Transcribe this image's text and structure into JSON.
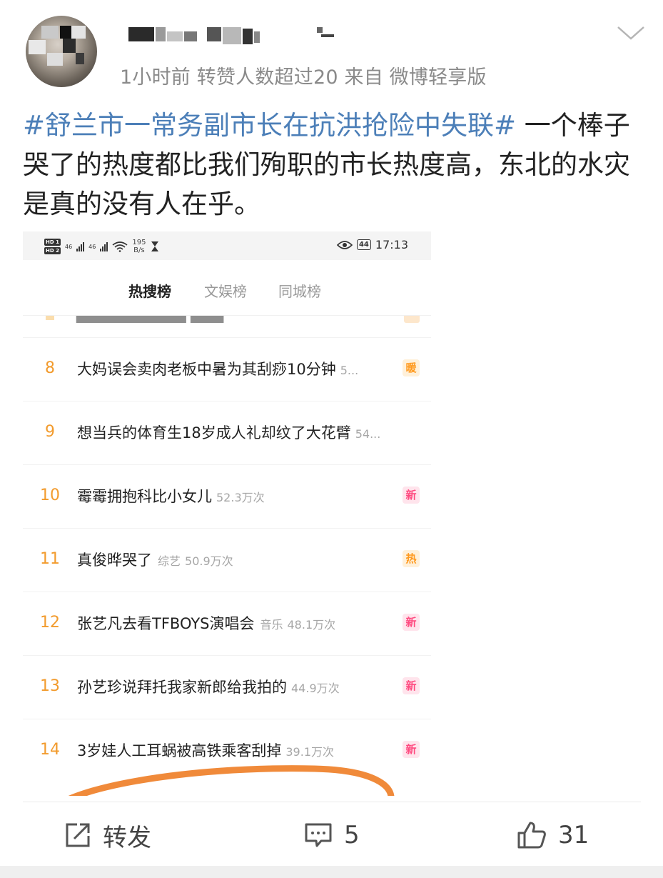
{
  "post": {
    "meta": "1小时前  转赞人数超过20   来自  微博轻享版",
    "hashtag": "#舒兰市一常务副市长在抗洪抢险中失联#",
    "body": " 一个棒子哭了的热度都比我们殉职的市长热度高，东北的水灾是真的没有人在乎。"
  },
  "screenshot": {
    "status_bar": {
      "hd1": "HD 1",
      "hd2": "HD 2",
      "net1": "46",
      "net2": "46",
      "speed_value": "195",
      "speed_unit": "B/s",
      "battery": "44",
      "time": "17:13"
    },
    "tabs": [
      {
        "label": "热搜榜",
        "active": true
      },
      {
        "label": "文娱榜",
        "active": false
      },
      {
        "label": "同城榜",
        "active": false
      }
    ],
    "rows": [
      {
        "rank": "8",
        "title": "大妈误会卖肉老板中暑为其刮痧10分钟",
        "category": "",
        "count": "5...",
        "badge": "暖",
        "badge_type": "warm"
      },
      {
        "rank": "9",
        "title": "想当兵的体育生18岁成人礼却纹了大花臂",
        "category": "",
        "count": "54...",
        "badge": "",
        "badge_type": ""
      },
      {
        "rank": "10",
        "title": "霉霉拥抱科比小女儿",
        "category": "",
        "count": "52.3万次",
        "badge": "新",
        "badge_type": "new"
      },
      {
        "rank": "11",
        "title": "真俊晔哭了",
        "category": "综艺",
        "count": "50.9万次",
        "badge": "热",
        "badge_type": "hot"
      },
      {
        "rank": "12",
        "title": "张艺凡去看TFBOYS演唱会",
        "category": "音乐",
        "count": "48.1万次",
        "badge": "新",
        "badge_type": "new"
      },
      {
        "rank": "13",
        "title": "孙艺珍说拜托我家新郎给我拍的",
        "category": "",
        "count": "44.9万次",
        "badge": "新",
        "badge_type": "new"
      },
      {
        "rank": "14",
        "title": "3岁娃人工耳蜗被高铁乘客刮掉",
        "category": "",
        "count": "39.1万次",
        "badge": "新",
        "badge_type": "new"
      }
    ]
  },
  "actions": {
    "repost_label": "转发",
    "comment_count": "5",
    "like_count": "31"
  },
  "colors": {
    "hashtag": "#4c7fb8",
    "rank": "#f29b2d",
    "tab_underline": "#ff8200",
    "highlight_circle": "#f08a3a"
  },
  "icons": [
    "chevron-down-icon",
    "repost-icon",
    "comment-icon",
    "like-icon",
    "eye-icon",
    "hourglass-icon",
    "wifi-icon",
    "signal-icon"
  ]
}
